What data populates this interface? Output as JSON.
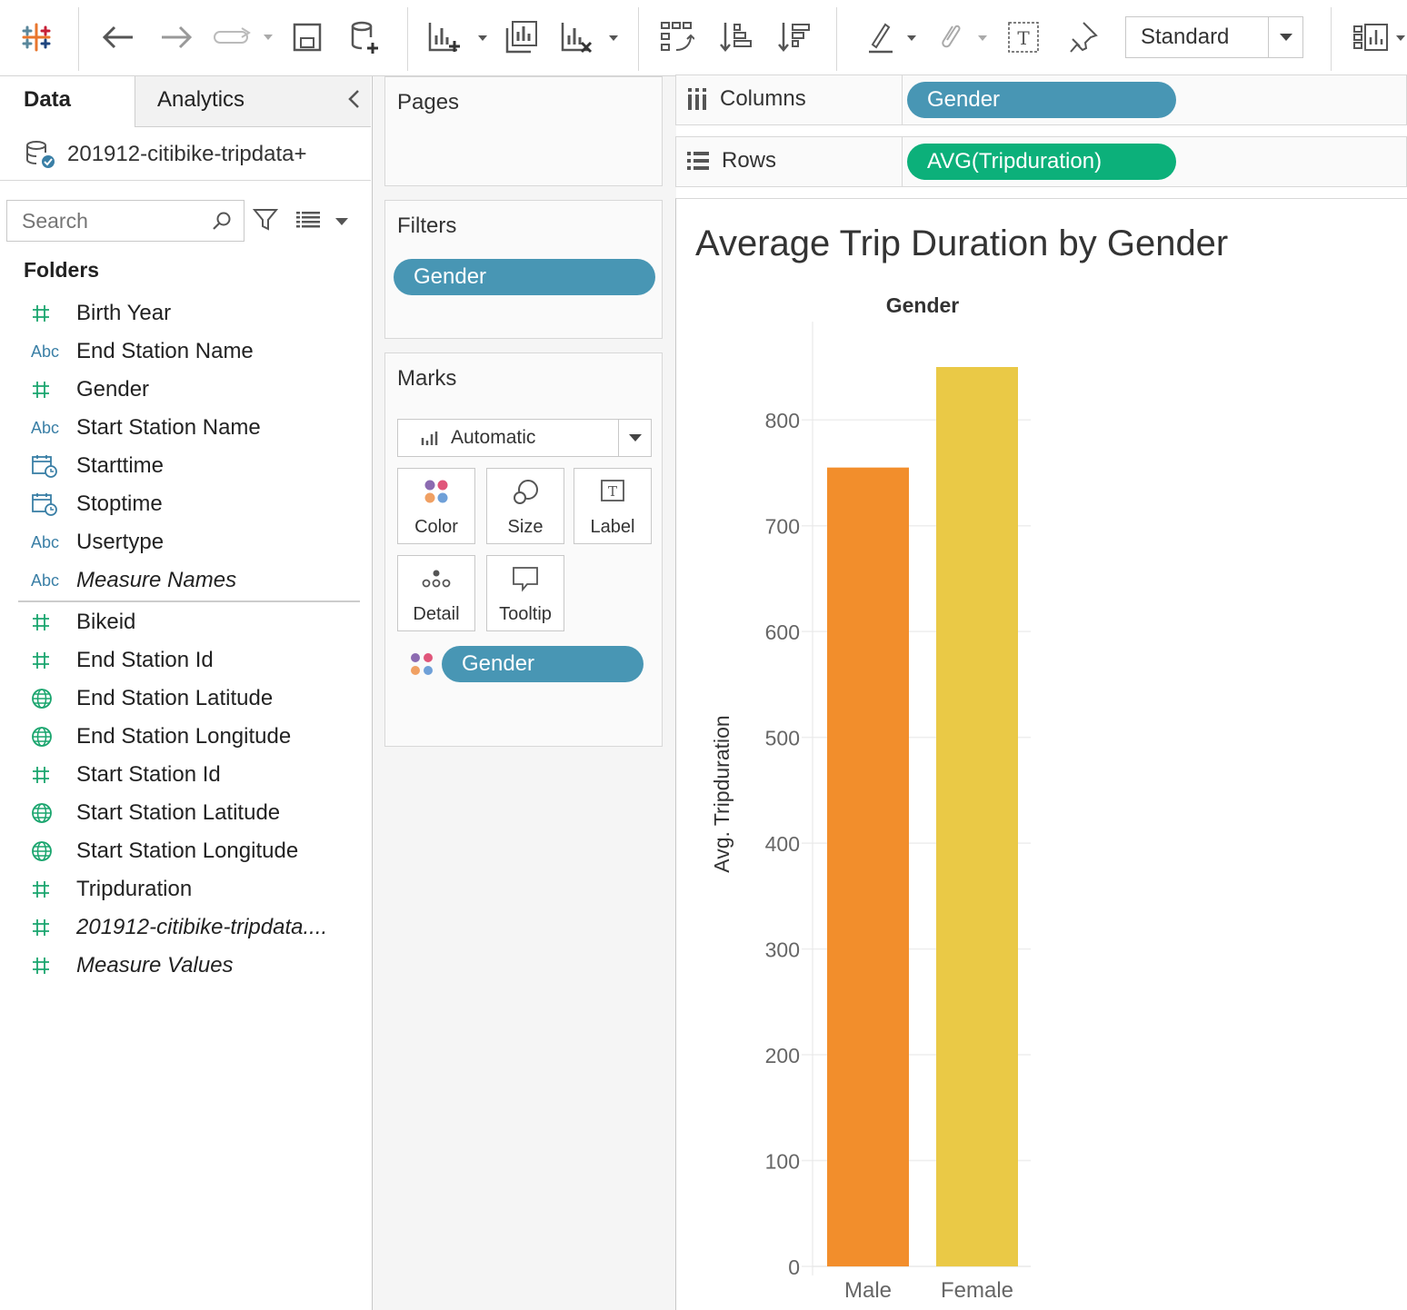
{
  "toolbar": {
    "fit_select": "Standard"
  },
  "sidebar": {
    "tabs": {
      "data": "Data",
      "analytics": "Analytics"
    },
    "datasource": "201912-citibike-tripdata+",
    "search_placeholder": "Search",
    "folders_label": "Folders",
    "dimensions": [
      {
        "type": "hash",
        "name": "Birth Year"
      },
      {
        "type": "abc",
        "name": "End Station Name"
      },
      {
        "type": "hash",
        "name": "Gender"
      },
      {
        "type": "abc",
        "name": "Start Station Name"
      },
      {
        "type": "date",
        "name": "Starttime"
      },
      {
        "type": "date",
        "name": "Stoptime"
      },
      {
        "type": "abc",
        "name": "Usertype"
      },
      {
        "type": "abc",
        "name": "Measure Names",
        "italic": true
      }
    ],
    "measures": [
      {
        "type": "hash",
        "name": "Bikeid"
      },
      {
        "type": "hash",
        "name": "End Station Id"
      },
      {
        "type": "geo",
        "name": "End Station Latitude"
      },
      {
        "type": "geo",
        "name": "End Station Longitude"
      },
      {
        "type": "hash",
        "name": "Start Station Id"
      },
      {
        "type": "geo",
        "name": "Start Station Latitude"
      },
      {
        "type": "geo",
        "name": "Start Station Longitude"
      },
      {
        "type": "hash",
        "name": "Tripduration"
      },
      {
        "type": "hash",
        "name": "201912-citibike-tripdata....",
        "italic": true
      },
      {
        "type": "hash",
        "name": "Measure Values",
        "italic": true
      }
    ]
  },
  "cards": {
    "pages": "Pages",
    "filters": "Filters",
    "filter_pill": "Gender",
    "marks": "Marks",
    "mark_type": "Automatic",
    "buttons": {
      "color": "Color",
      "size": "Size",
      "label": "Label",
      "detail": "Detail",
      "tooltip": "Tooltip"
    },
    "color_pill": "Gender"
  },
  "shelves": {
    "columns_label": "Columns",
    "columns_pill": "Gender",
    "rows_label": "Rows",
    "rows_pill": "AVG(Tripduration)"
  },
  "chart_data": {
    "type": "bar",
    "title": "Average Trip Duration by Gender",
    "header": "Gender",
    "ylabel": "Avg. Tripduration",
    "categories": [
      "Male",
      "Female"
    ],
    "values": [
      755,
      850
    ],
    "colors": [
      "#f28e2c",
      "#eac946"
    ],
    "ylim": [
      0,
      850
    ],
    "yticks": [
      0,
      100,
      200,
      300,
      400,
      500,
      600,
      700,
      800
    ],
    "grid": true
  }
}
